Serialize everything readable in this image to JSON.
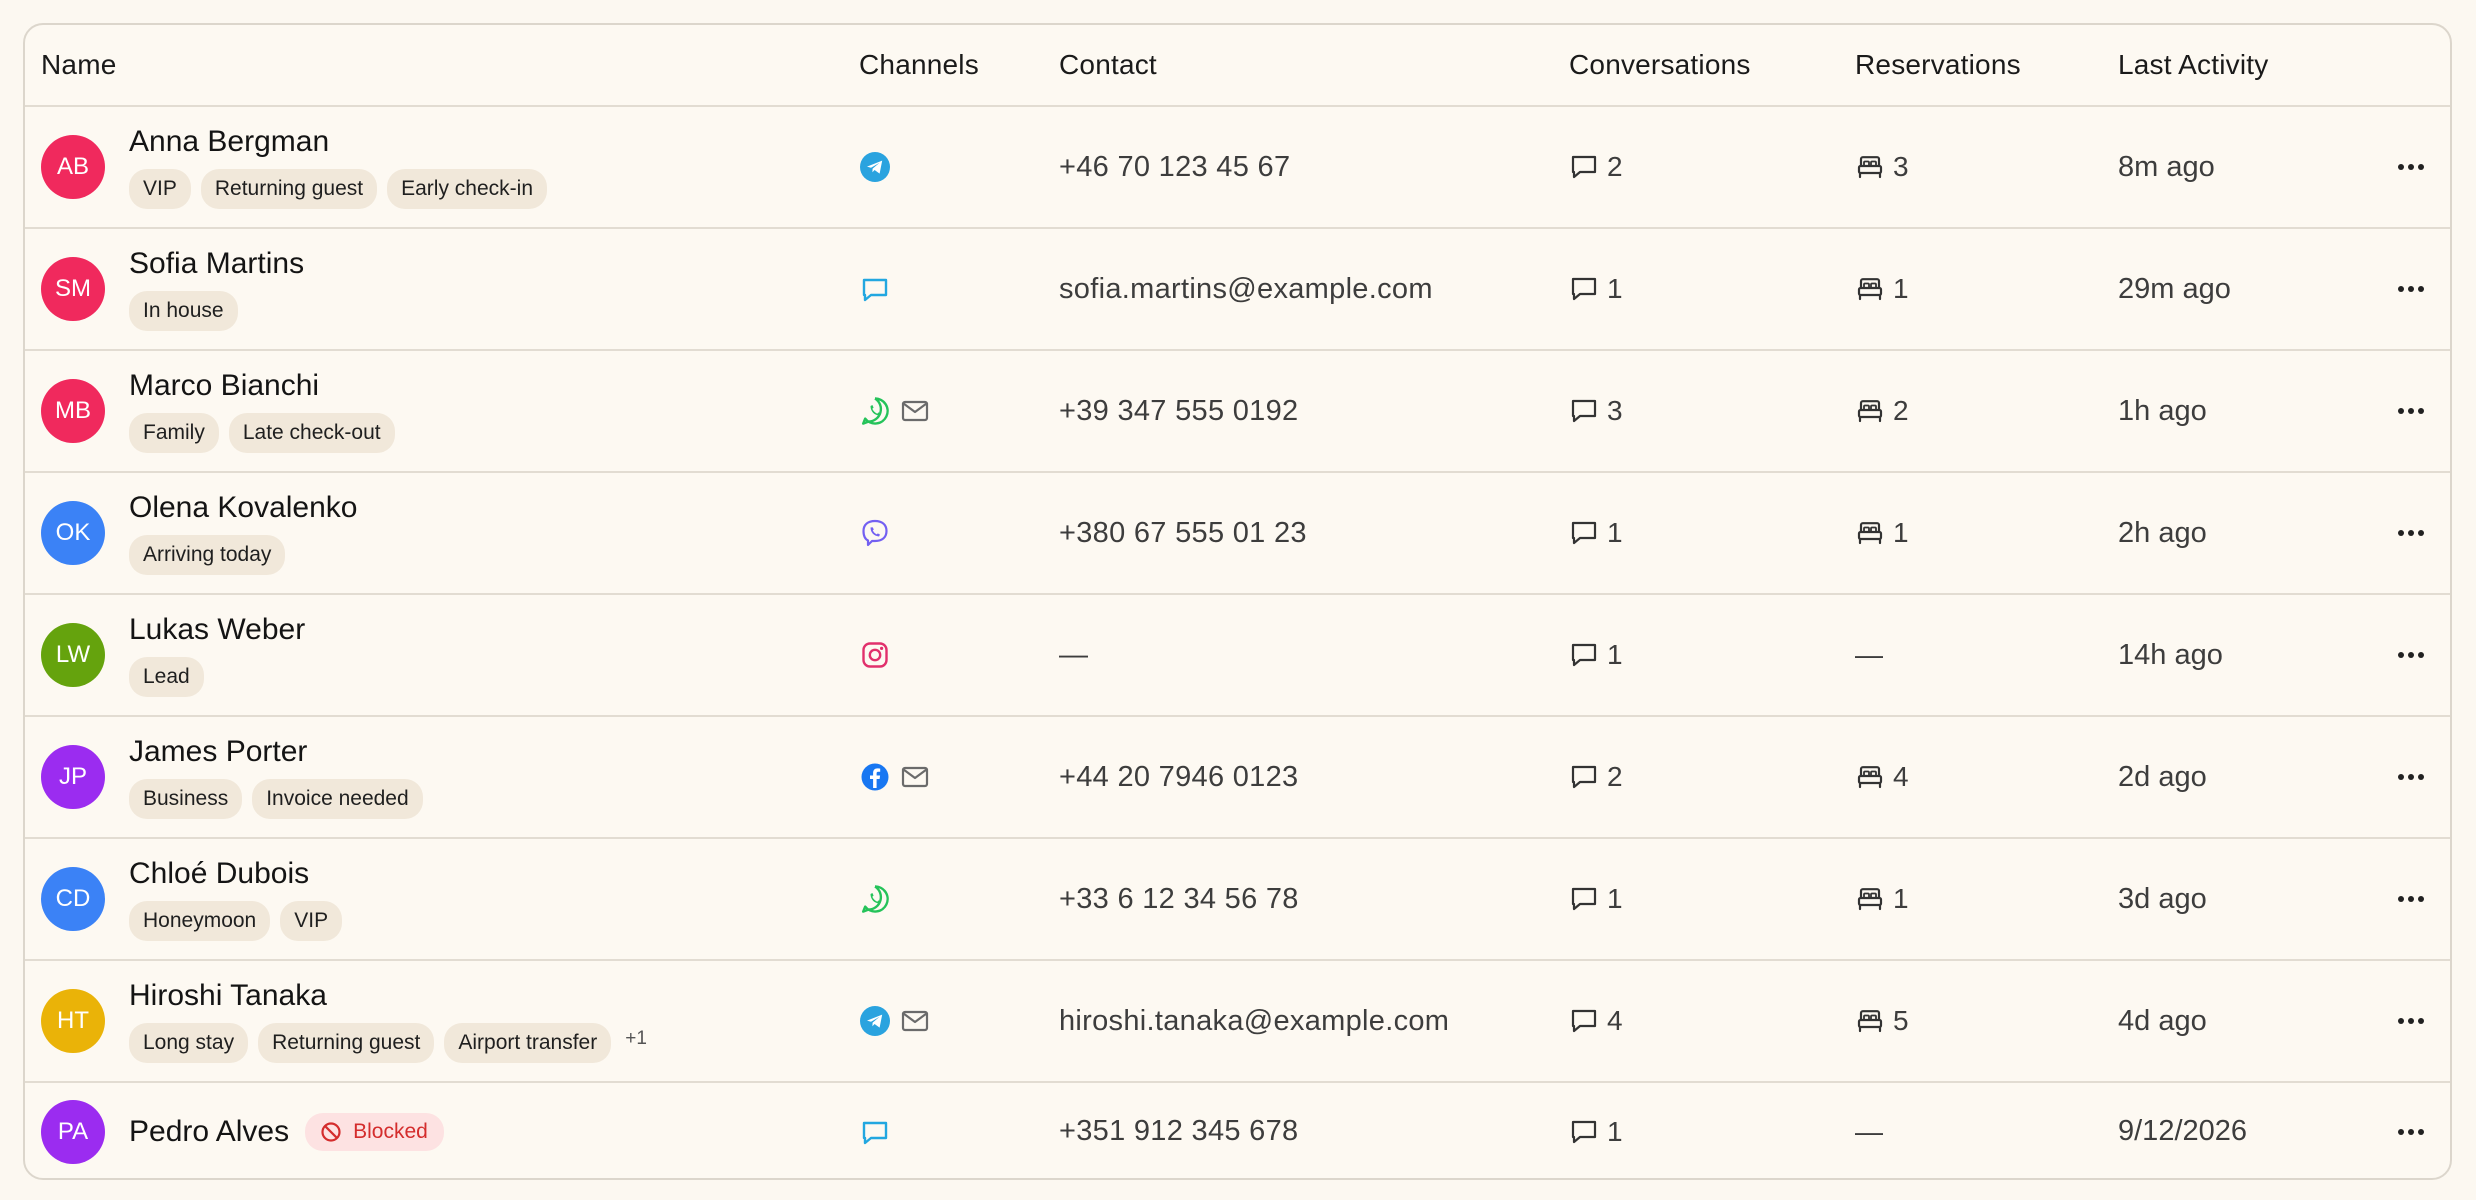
{
  "headers": {
    "name": "Name",
    "channels": "Channels",
    "contact": "Contact",
    "conversations": "Conversations",
    "reservations": "Reservations",
    "last_activity": "Last Activity"
  },
  "colors": {
    "red": "#f0295d",
    "blue": "#3b82f6",
    "green": "#65a30d",
    "purple": "#9b2cf0",
    "amber": "#eab308"
  },
  "guests": [
    {
      "initials": "AB",
      "avatar_color": "#f0295d",
      "name": "Anna Bergman",
      "tags": [
        "VIP",
        "Returning guest",
        "Early check-in"
      ],
      "more": "",
      "blocked": "",
      "channels": [
        "telegram-icon"
      ],
      "contact": "+46 70 123 45 67",
      "conversations": "2",
      "reservations": "3",
      "last": "8m ago"
    },
    {
      "initials": "SM",
      "avatar_color": "#f0295d",
      "name": "Sofia Martins",
      "tags": [
        "In house"
      ],
      "more": "",
      "blocked": "",
      "channels": [
        "chat-icon"
      ],
      "contact": "sofia.martins@example.com",
      "conversations": "1",
      "reservations": "1",
      "last": "29m ago"
    },
    {
      "initials": "MB",
      "avatar_color": "#f0295d",
      "name": "Marco Bianchi",
      "tags": [
        "Family",
        "Late check-out"
      ],
      "more": "",
      "blocked": "",
      "channels": [
        "whatsapp-icon",
        "mail-icon"
      ],
      "contact": "+39 347 555 0192",
      "conversations": "3",
      "reservations": "2",
      "last": "1h ago"
    },
    {
      "initials": "OK",
      "avatar_color": "#3b82f6",
      "name": "Olena Kovalenko",
      "tags": [
        "Arriving today"
      ],
      "more": "",
      "blocked": "",
      "channels": [
        "viber-icon"
      ],
      "contact": "+380 67 555 01 23",
      "conversations": "1",
      "reservations": "1",
      "last": "2h ago"
    },
    {
      "initials": "LW",
      "avatar_color": "#65a30d",
      "name": "Lukas Weber",
      "tags": [
        "Lead"
      ],
      "more": "",
      "blocked": "",
      "channels": [
        "instagram-icon"
      ],
      "contact": "—",
      "conversations": "1",
      "reservations": "—",
      "last": "14h ago"
    },
    {
      "initials": "JP",
      "avatar_color": "#9b2cf0",
      "name": "James Porter",
      "tags": [
        "Business",
        "Invoice needed"
      ],
      "more": "",
      "blocked": "",
      "channels": [
        "facebook-icon",
        "mail-icon"
      ],
      "contact": "+44 20 7946 0123",
      "conversations": "2",
      "reservations": "4",
      "last": "2d ago"
    },
    {
      "initials": "CD",
      "avatar_color": "#3b82f6",
      "name": "Chloé Dubois",
      "tags": [
        "Honeymoon",
        "VIP"
      ],
      "more": "",
      "blocked": "",
      "channels": [
        "whatsapp-icon"
      ],
      "contact": "+33 6 12 34 56 78",
      "conversations": "1",
      "reservations": "1",
      "last": "3d ago"
    },
    {
      "initials": "HT",
      "avatar_color": "#eab308",
      "name": "Hiroshi Tanaka",
      "tags": [
        "Long stay",
        "Returning guest",
        "Airport transfer"
      ],
      "more": "+1",
      "blocked": "",
      "channels": [
        "telegram-icon",
        "mail-icon"
      ],
      "contact": "hiroshi.tanaka@example.com",
      "conversations": "4",
      "reservations": "5",
      "last": "4d ago"
    },
    {
      "initials": "PA",
      "avatar_color": "#9b2cf0",
      "name": "Pedro Alves",
      "tags": [],
      "more": "",
      "blocked": "Blocked",
      "channels": [
        "chat-icon"
      ],
      "contact": "+351 912 345 678",
      "conversations": "1",
      "reservations": "—",
      "last": "9/12/2026"
    }
  ]
}
